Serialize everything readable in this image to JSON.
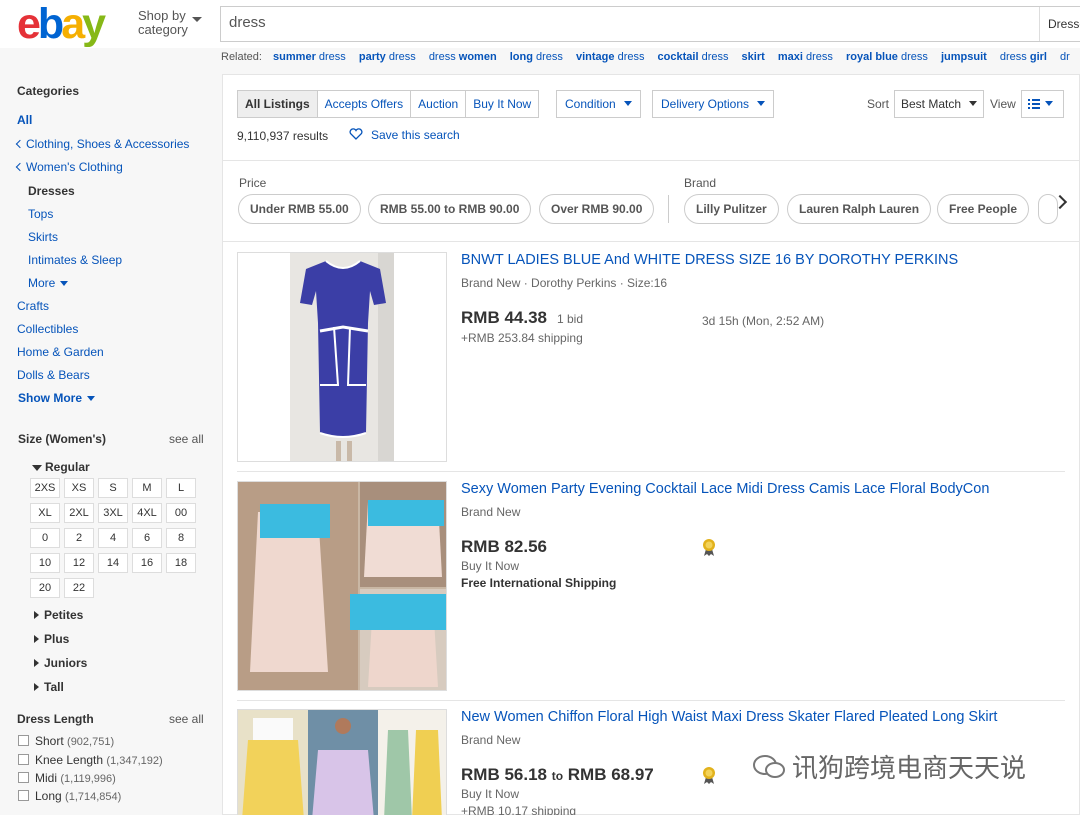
{
  "header": {
    "logo_text": "ebay",
    "shop_by": "Shop by category",
    "search_value": "dress",
    "search_category": "Dresses"
  },
  "related": {
    "label": "Related:",
    "items": [
      {
        "bold": "summer",
        "rest": " dress"
      },
      {
        "bold": "party",
        "rest": " dress"
      },
      {
        "bold": "",
        "rest": "dress ",
        "bold2": "women"
      },
      {
        "bold": "long",
        "rest": " dress"
      },
      {
        "bold": "vintage",
        "rest": " dress"
      },
      {
        "bold": "cocktail",
        "rest": " dress"
      },
      {
        "bold": "skirt",
        "rest": ""
      },
      {
        "bold": "maxi",
        "rest": " dress"
      },
      {
        "bold": "royal blue",
        "rest": " dress"
      },
      {
        "bold": "jumpsuit",
        "rest": ""
      },
      {
        "bold": "",
        "rest": "dress ",
        "bold2": "girl"
      },
      {
        "bold": "",
        "rest": "dr"
      }
    ]
  },
  "sidebar": {
    "categories_heading": "Categories",
    "all": "All",
    "clothing": "Clothing, Shoes & Accessories",
    "womens": "Women's Clothing",
    "dresses": "Dresses",
    "tops": "Tops",
    "skirts": "Skirts",
    "intimates": "Intimates & Sleep",
    "more": "More",
    "crafts": "Crafts",
    "collectibles": "Collectibles",
    "home_garden": "Home & Garden",
    "dolls_bears": "Dolls & Bears",
    "show_more": "Show More",
    "size_heading": "Size (Women's)",
    "see_all": "see all",
    "regular": "Regular",
    "sizes": [
      "2XS",
      "XS",
      "S",
      "M",
      "L",
      "XL",
      "2XL",
      "3XL",
      "4XL",
      "00",
      "0",
      "2",
      "4",
      "6",
      "8",
      "10",
      "12",
      "14",
      "16",
      "18",
      "20",
      "22"
    ],
    "petites": "Petites",
    "plus": "Plus",
    "juniors": "Juniors",
    "tall": "Tall",
    "dress_length_heading": "Dress Length",
    "see_all_2": "see all",
    "lengths": [
      {
        "label": "Short",
        "count": "(902,751)"
      },
      {
        "label": "Knee Length",
        "count": "(1,347,192)"
      },
      {
        "label": "Midi",
        "count": "(1,119,996)"
      },
      {
        "label": "Long",
        "count": "(1,714,854)"
      }
    ]
  },
  "toolbar": {
    "tabs": [
      "All Listings",
      "Accepts Offers",
      "Auction",
      "Buy It Now"
    ],
    "condition": "Condition",
    "delivery": "Delivery Options",
    "sort_label": "Sort",
    "sort_value": "Best Match",
    "view_label": "View",
    "results": "9,110,937 results",
    "save_search": "Save this search"
  },
  "filters": {
    "price_label": "Price",
    "brand_label": "Brand",
    "price_pills": [
      "Under RMB 55.00",
      "RMB 55.00 to RMB 90.00",
      "Over RMB 90.00"
    ],
    "brand_pills": [
      "Lilly Pulitzer",
      "Lauren Ralph Lauren",
      "Free People"
    ]
  },
  "listings": [
    {
      "title": "BNWT LADIES BLUE And WHITE DRESS SIZE 16 BY DOROTHY PERKINS",
      "subtitle": "Brand New · Dorothy Perkins · Size:16",
      "price": "RMB 44.38",
      "bids": "1 bid",
      "shipping": "+RMB 253.84 shipping",
      "time_left": "3d 15h (Mon, 2:52 AM)"
    },
    {
      "title": "Sexy Women Party Evening Cocktail Lace Midi Dress Camis Lace Floral BodyCon",
      "subtitle": "Brand New",
      "price": "RMB 82.56",
      "format": "Buy It Now",
      "shipping": "Free International Shipping"
    },
    {
      "title": "New Women Chiffon Floral High Waist Maxi Dress Skater Flared Pleated Long Skirt",
      "subtitle": "Brand New",
      "price_low": "RMB 56.18",
      "price_to": "to",
      "price_high": "RMB 68.97",
      "format": "Buy It Now",
      "shipping": "+RMB 10.17 shipping"
    }
  ],
  "watermark": "讯狗跨境电商天天说"
}
